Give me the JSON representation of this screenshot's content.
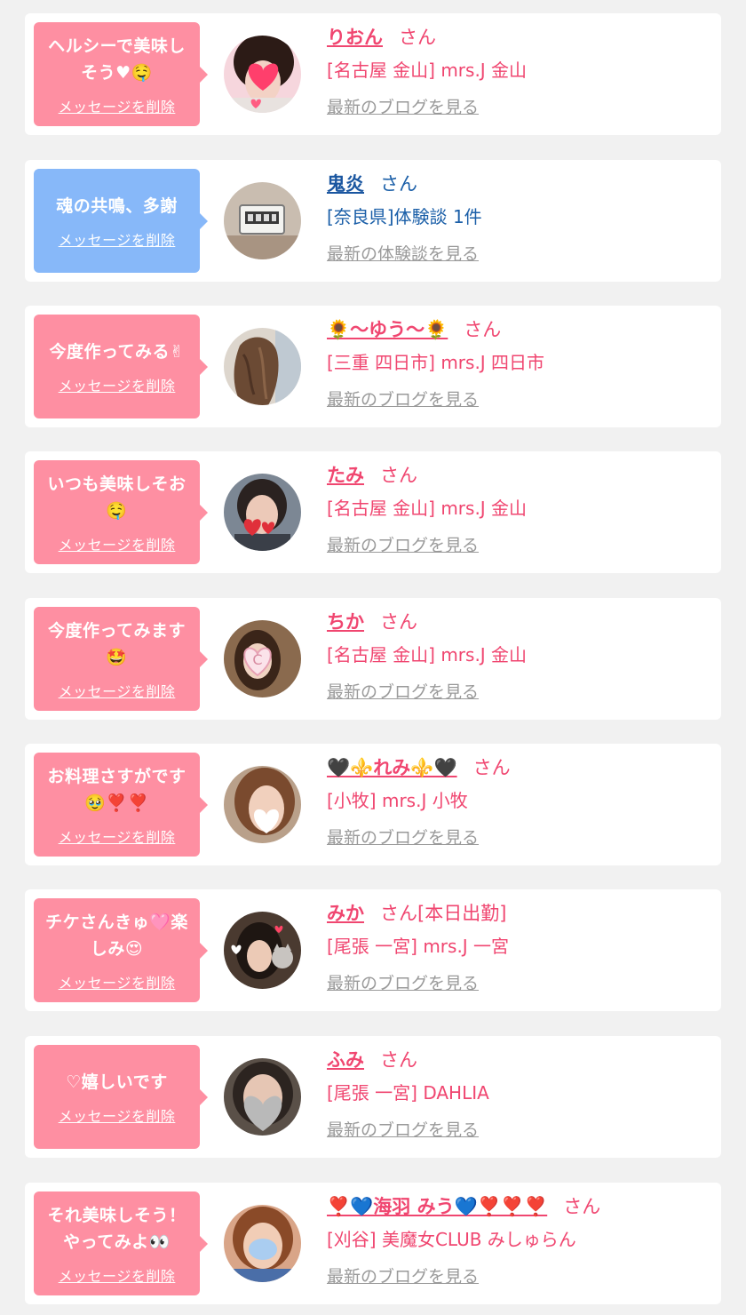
{
  "theme": {
    "pink": "#fe8fa2",
    "blue": "#87b8f9",
    "name_pink": "#f04670",
    "name_blue": "#1a56a0",
    "link_gray": "#9a9a9a"
  },
  "cards": [
    {
      "color": "pink",
      "message": "ヘルシーで美味しそう♥🤤",
      "delete_label": "メッセージを削除",
      "name": "りおん",
      "suffix": "さん",
      "shop": "[名古屋 金山] mrs.J 金山",
      "link": "最新のブログを見る",
      "avatar_icon": "profile-photo-heart-sticker"
    },
    {
      "color": "blue",
      "message": "魂の共鳴、多謝",
      "delete_label": "メッセージを削除",
      "name": "鬼炎",
      "suffix": "さん",
      "shop": "[奈良県]体験談 1件",
      "link": "最新の体験談を見る",
      "avatar_icon": "profile-photo-clock"
    },
    {
      "color": "pink",
      "message": "今度作ってみる✌",
      "delete_label": "メッセージを削除",
      "name": "🌻〜ゆう〜🌻",
      "suffix": "さん",
      "shop": "[三重 四日市] mrs.J 四日市",
      "link": "最新のブログを見る",
      "avatar_icon": "profile-photo-hair"
    },
    {
      "color": "pink",
      "message": "いつも美味しそお🤤",
      "delete_label": "メッセージを削除",
      "name": "たみ",
      "suffix": "さん",
      "shop": "[名古屋 金山] mrs.J 金山",
      "link": "最新のブログを見る",
      "avatar_icon": "profile-photo-heart-sticker"
    },
    {
      "color": "pink",
      "message": "今度作ってみます🤩",
      "delete_label": "メッセージを削除",
      "name": "ちか",
      "suffix": "さん",
      "shop": "[名古屋 金山] mrs.J 金山",
      "link": "最新のブログを見る",
      "avatar_icon": "profile-photo-heart-c-sticker"
    },
    {
      "color": "pink",
      "message": "お料理さすがです🥹❣️❣️",
      "delete_label": "メッセージを削除",
      "name": "🖤⚜️れみ⚜️🖤",
      "suffix": "さん",
      "shop": "[小牧] mrs.J 小牧",
      "link": "最新のブログを見る",
      "avatar_icon": "profile-photo-white-heart"
    },
    {
      "color": "pink",
      "message": "チケさんきゅ🩷楽しみ😍",
      "delete_label": "メッセージを削除",
      "name": "みか",
      "suffix": "さん[本日出勤]",
      "shop": "[尾張 一宮] mrs.J 一宮",
      "link": "最新のブログを見る",
      "avatar_icon": "profile-photo-cat-stickers"
    },
    {
      "color": "pink",
      "message": "♡嬉しいです",
      "delete_label": "メッセージを削除",
      "name": "ふみ",
      "suffix": "さん",
      "shop": "[尾張 一宮] DAHLIA",
      "link": "最新のブログを見る",
      "avatar_icon": "profile-photo-gray-heart"
    },
    {
      "color": "pink",
      "message": "それ美味しそう！やってみよ👀",
      "delete_label": "メッセージを削除",
      "name": "❣️💙海羽 みう💙❣️❣️❣️",
      "suffix": "さん",
      "shop": "[刈谷] 美魔女CLUB みしゅらん",
      "link": "最新のブログを見る",
      "avatar_icon": "profile-photo-blue-mask"
    }
  ]
}
